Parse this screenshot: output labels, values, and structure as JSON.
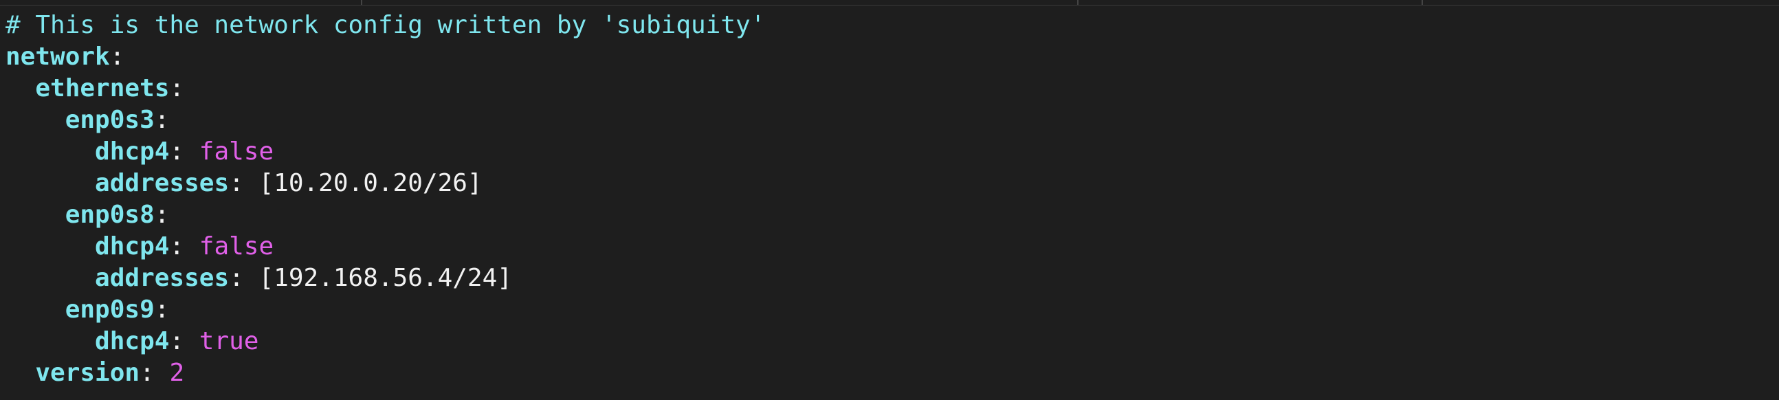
{
  "editor": {
    "lines": [
      {
        "comment": "# This is the network config written by 'subiquity'"
      },
      {
        "key": "network",
        "colon": ":"
      },
      {
        "indent": "  ",
        "key": "ethernets",
        "colon": ":"
      },
      {
        "indent": "    ",
        "key": "enp0s3",
        "colon": ":"
      },
      {
        "indent": "      ",
        "key": "dhcp4",
        "colon": ": ",
        "value": "false"
      },
      {
        "indent": "      ",
        "key": "addresses",
        "colon": ": ",
        "value": "[10.20.0.20/26]"
      },
      {
        "indent": "    ",
        "key": "enp0s8",
        "colon": ":"
      },
      {
        "indent": "      ",
        "key": "dhcp4",
        "colon": ": ",
        "value": "false"
      },
      {
        "indent": "      ",
        "key": "addresses",
        "colon": ": ",
        "value": "[192.168.56.4/24]"
      },
      {
        "indent": "    ",
        "key": "enp0s9",
        "colon": ":"
      },
      {
        "indent": "      ",
        "key": "dhcp4",
        "colon": ": ",
        "value": "true"
      },
      {
        "indent": "  ",
        "key": "version",
        "colon": ": ",
        "value": "2"
      }
    ]
  },
  "colors": {
    "background": "#1e1e1e",
    "key": "#7fe6ee",
    "literal": "#e060e8",
    "text": "#f2f2f2"
  }
}
